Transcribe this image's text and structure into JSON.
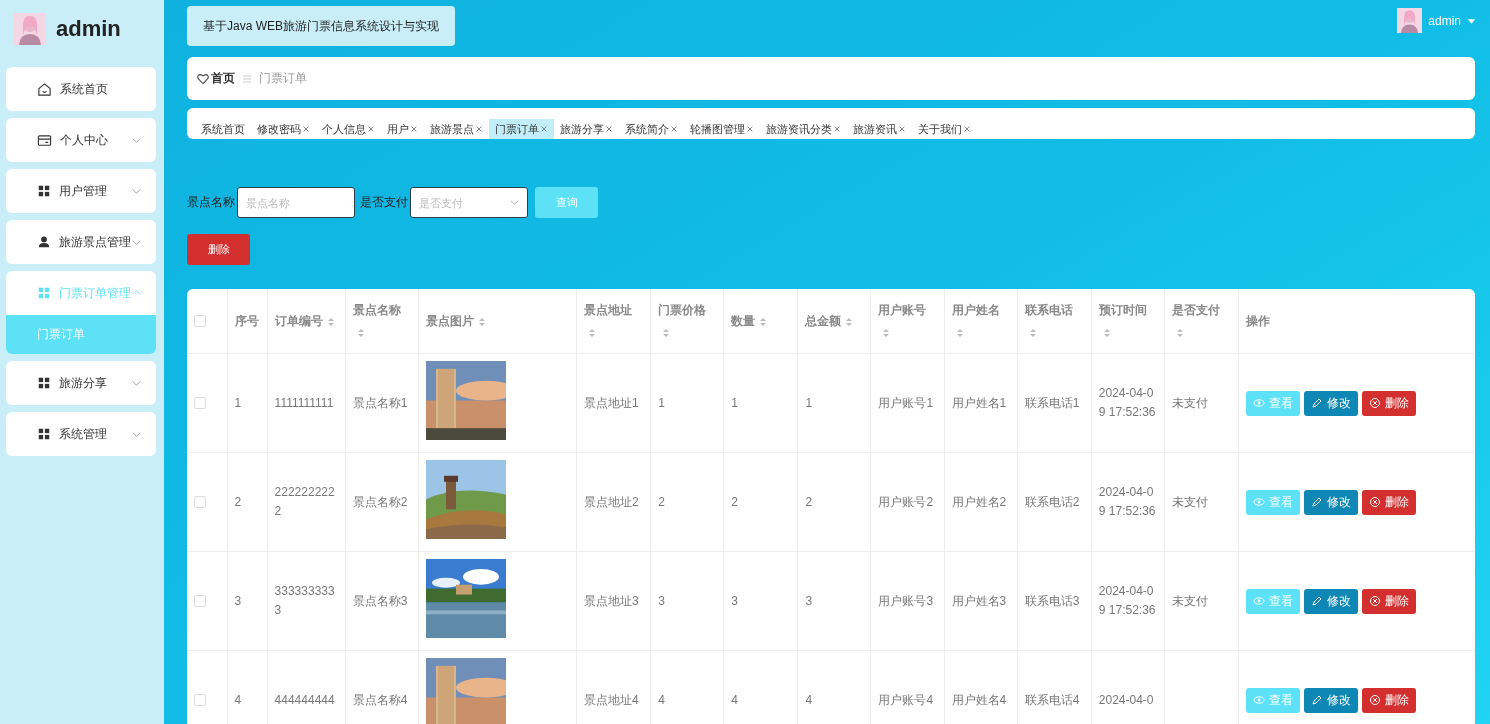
{
  "sidebar": {
    "user": "admin",
    "menu": [
      {
        "label": "系统首页",
        "expanded": false,
        "selected": false,
        "has_children": false
      },
      {
        "label": "个人中心",
        "expanded": false,
        "selected": false,
        "has_children": true
      },
      {
        "label": "用户管理",
        "expanded": false,
        "selected": false,
        "has_children": true
      },
      {
        "label": "旅游景点管理",
        "expanded": false,
        "selected": false,
        "has_children": true
      },
      {
        "label": "门票订单管理",
        "expanded": true,
        "selected": true,
        "has_children": true,
        "children": [
          {
            "label": "门票订单",
            "selected": true
          }
        ]
      },
      {
        "label": "旅游分享",
        "expanded": false,
        "selected": false,
        "has_children": true
      },
      {
        "label": "系统管理",
        "expanded": false,
        "selected": false,
        "has_children": true
      }
    ]
  },
  "header": {
    "title": "基于Java WEB旅游门票信息系统设计与实现",
    "user": "admin"
  },
  "breadcrumb": [
    "首页",
    "门票订单"
  ],
  "tabs": [
    {
      "label": "系统首页",
      "closable": false,
      "selected": false
    },
    {
      "label": "修改密码",
      "closable": true,
      "selected": false
    },
    {
      "label": "个人信息",
      "closable": true,
      "selected": false
    },
    {
      "label": "用户",
      "closable": true,
      "selected": false
    },
    {
      "label": "旅游景点",
      "closable": true,
      "selected": false
    },
    {
      "label": "门票订单",
      "closable": true,
      "selected": true
    },
    {
      "label": "旅游分享",
      "closable": true,
      "selected": false
    },
    {
      "label": "系统简介",
      "closable": true,
      "selected": false
    },
    {
      "label": "轮播图管理",
      "closable": true,
      "selected": false
    },
    {
      "label": "旅游资讯分类",
      "closable": true,
      "selected": false
    },
    {
      "label": "旅游资讯",
      "closable": true,
      "selected": false
    },
    {
      "label": "关于我们",
      "closable": true,
      "selected": false
    }
  ],
  "search": {
    "fields": [
      {
        "kind": "input",
        "label": "景点名称",
        "placeholder": "景点名称"
      },
      {
        "kind": "select",
        "label": "是否支付",
        "placeholder": "是否支付"
      }
    ],
    "query_button": "查询",
    "delete_button": "删除"
  },
  "table": {
    "select_all": {
      "checked": false
    },
    "columns": [
      {
        "label": "序号",
        "sortable": false
      },
      {
        "label": "订单编号",
        "sortable": true
      },
      {
        "label": "景点名称",
        "sortable": true
      },
      {
        "label": "景点图片",
        "sortable": true
      },
      {
        "label": "景点地址",
        "sortable": true
      },
      {
        "label": "门票价格",
        "sortable": true
      },
      {
        "label": "数量",
        "sortable": true
      },
      {
        "label": "总金额",
        "sortable": true
      },
      {
        "label": "用户账号",
        "sortable": true
      },
      {
        "label": "用户姓名",
        "sortable": true
      },
      {
        "label": "联系电话",
        "sortable": true
      },
      {
        "label": "预订时间",
        "sortable": true
      },
      {
        "label": "是否支付",
        "sortable": true
      },
      {
        "label": "操作",
        "sortable": false
      }
    ],
    "rows": [
      {
        "checked": false,
        "cells": [
          "1",
          "1111111111",
          "景点名称1",
          null,
          "景点地址1",
          "1",
          "1",
          "1",
          "用户账号1",
          "用户姓名1",
          "联系电话1",
          "2024-04-09 17:52:36",
          "未支付"
        ],
        "actions": [
          {
            "kind": "view",
            "label": "查看"
          },
          {
            "kind": "edit",
            "label": "修改"
          },
          {
            "kind": "delete",
            "label": "删除"
          }
        ]
      },
      {
        "checked": false,
        "cells": [
          "2",
          "2222222222",
          "景点名称2",
          null,
          "景点地址2",
          "2",
          "2",
          "2",
          "用户账号2",
          "用户姓名2",
          "联系电话2",
          "2024-04-09 17:52:36",
          "未支付"
        ],
        "actions": [
          {
            "kind": "view",
            "label": "查看"
          },
          {
            "kind": "edit",
            "label": "修改"
          },
          {
            "kind": "delete",
            "label": "删除"
          }
        ]
      },
      {
        "checked": false,
        "cells": [
          "3",
          "3333333333",
          "景点名称3",
          null,
          "景点地址3",
          "3",
          "3",
          "3",
          "用户账号3",
          "用户姓名3",
          "联系电话3",
          "2024-04-09 17:52:36",
          "未支付"
        ],
        "actions": [
          {
            "kind": "view",
            "label": "查看"
          },
          {
            "kind": "edit",
            "label": "修改"
          },
          {
            "kind": "delete",
            "label": "删除"
          }
        ]
      },
      {
        "checked": false,
        "cells": [
          "4",
          "444444444",
          "景点名称4",
          null,
          "景点地址4",
          "4",
          "4",
          "4",
          "用户账号4",
          "用户姓名4",
          "联系电话4",
          "2024-04-0",
          null
        ],
        "actions": [
          {
            "kind": "view",
            "label": "查看"
          },
          {
            "kind": "edit",
            "label": "修改"
          },
          {
            "kind": "delete",
            "label": "删除"
          }
        ]
      }
    ]
  }
}
